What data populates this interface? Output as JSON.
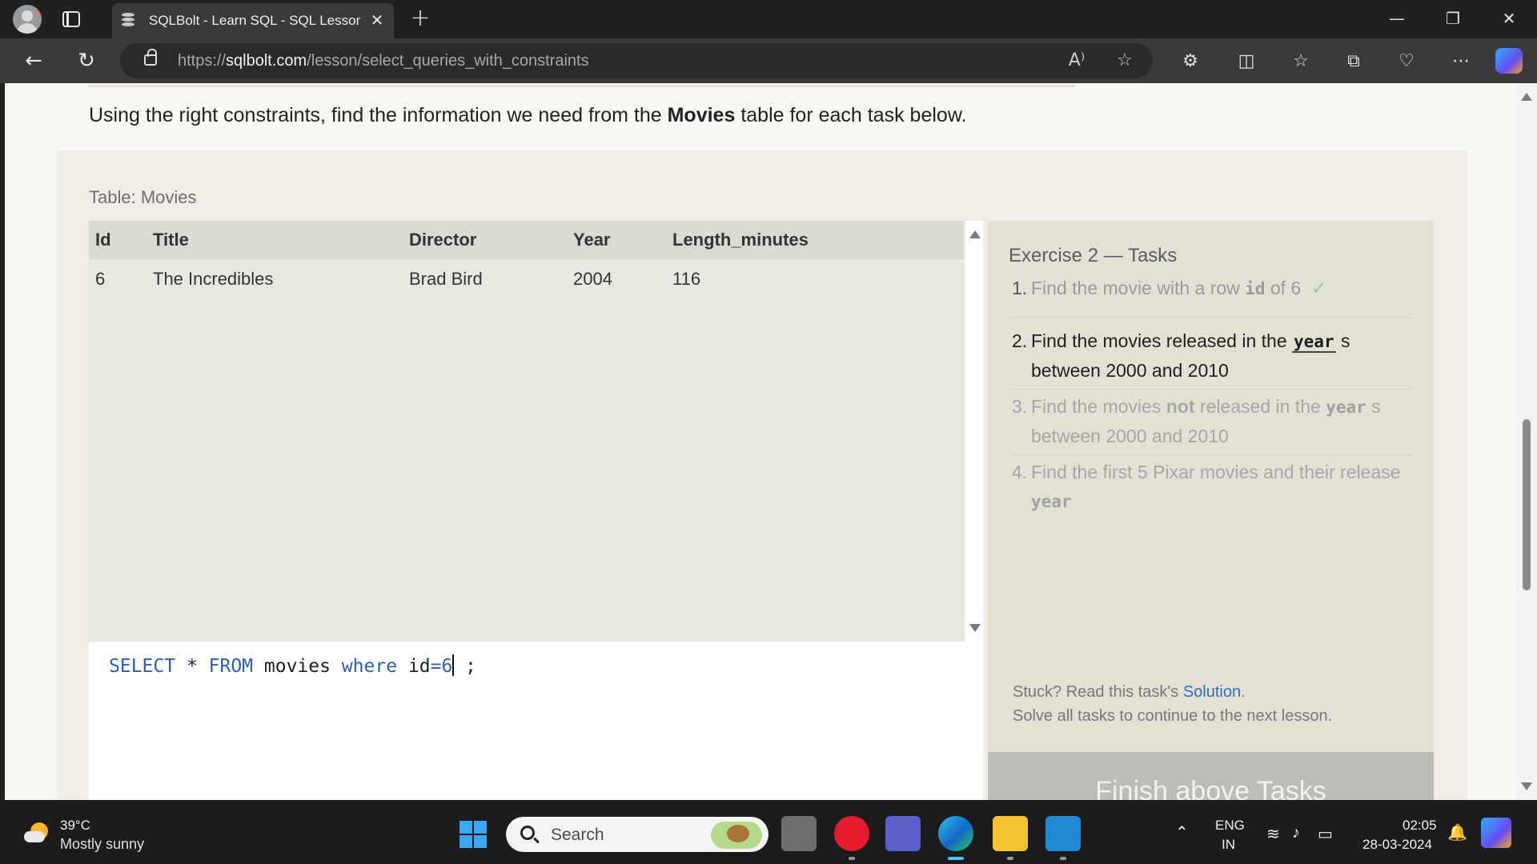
{
  "browser": {
    "tab_title": "SQLBolt - Learn SQL - SQL Lesson",
    "tab_close": "✕",
    "new_tab": "+",
    "url_prefix": "https://",
    "url_domain": "sqlbolt.com",
    "url_path": "/lesson/select_queries_with_constraints",
    "read_aloud_icon": "A⁾",
    "window_controls": [
      "minimize",
      "restore",
      "close"
    ]
  },
  "intro": {
    "before": "Using the right constraints, find the information we need from the ",
    "table_word": "Movies",
    "after": " table for each task below."
  },
  "table": {
    "caption": "Table: Movies",
    "columns": [
      "Id",
      "Title",
      "Director",
      "Year",
      "Length_minutes"
    ],
    "rows": [
      [
        "6",
        "The Incredibles",
        "Brad Bird",
        "2004",
        "116"
      ]
    ]
  },
  "editor": {
    "kw_select": "SELECT",
    "star": " * ",
    "kw_from": "FROM",
    "table_name": " movies ",
    "kw_where": "where",
    "cond_left": " id",
    "cond_op": "=6",
    "tail": " ;"
  },
  "exercise": {
    "title": "Exercise 2 — Tasks",
    "tasks": [
      {
        "num": "1.",
        "pre": "Find the movie with a row ",
        "code": "id",
        "post": " of 6",
        "check": "✓",
        "status": "done"
      },
      {
        "num": "2.",
        "pre": "Find the movies released in the ",
        "code": "year",
        "post": " s between 2000 and 2010",
        "status": "active"
      },
      {
        "num": "3.",
        "pre": "Find the movies ",
        "strong": "not",
        "mid": " released in the ",
        "code": "year",
        "post": " s between 2000 and 2010",
        "status": "todo"
      },
      {
        "num": "4.",
        "pre": "Find the first 5 Pixar movies and their release ",
        "code": "year",
        "status": "todo"
      }
    ],
    "stuck_pre": "Stuck? Read this task's ",
    "stuck_link": "Solution",
    "stuck_post": ".",
    "continue_note": "Solve all tasks to continue to the next lesson.",
    "finish_button": "Finish above Tasks"
  },
  "taskbar": {
    "temperature": "39°C",
    "condition": "Mostly sunny",
    "search_label": "Search",
    "lang_1": "ENG",
    "lang_2": "IN",
    "time": "02:05",
    "date": "28-03-2024"
  },
  "colors": {
    "keyword": "#2e5fb0",
    "link": "#2f6dbf",
    "check": "#8ccf86"
  }
}
